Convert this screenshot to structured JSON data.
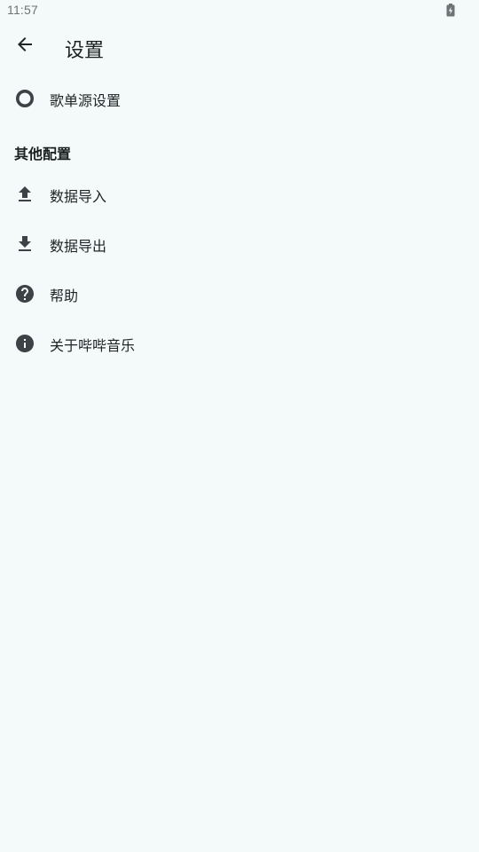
{
  "status_bar": {
    "time": "11:57",
    "battery_icon": "battery-charging-icon"
  },
  "app_bar": {
    "back_icon": "arrow-back-icon",
    "title": "设置"
  },
  "items_top": [
    {
      "label": "歌单源设置",
      "icon": "radio-ring-icon"
    }
  ],
  "section": {
    "title": "其他配置"
  },
  "items_other": [
    {
      "label": "数据导入",
      "icon": "upload-icon"
    },
    {
      "label": "数据导出",
      "icon": "download-icon"
    },
    {
      "label": "帮助",
      "icon": "help-circle-icon"
    },
    {
      "label": "关于哔哔音乐",
      "icon": "info-circle-icon"
    }
  ],
  "colors": {
    "background": "#f4f9f9",
    "icon": "#3c4245",
    "text": "#1f2426",
    "status_text": "#6d7374"
  }
}
